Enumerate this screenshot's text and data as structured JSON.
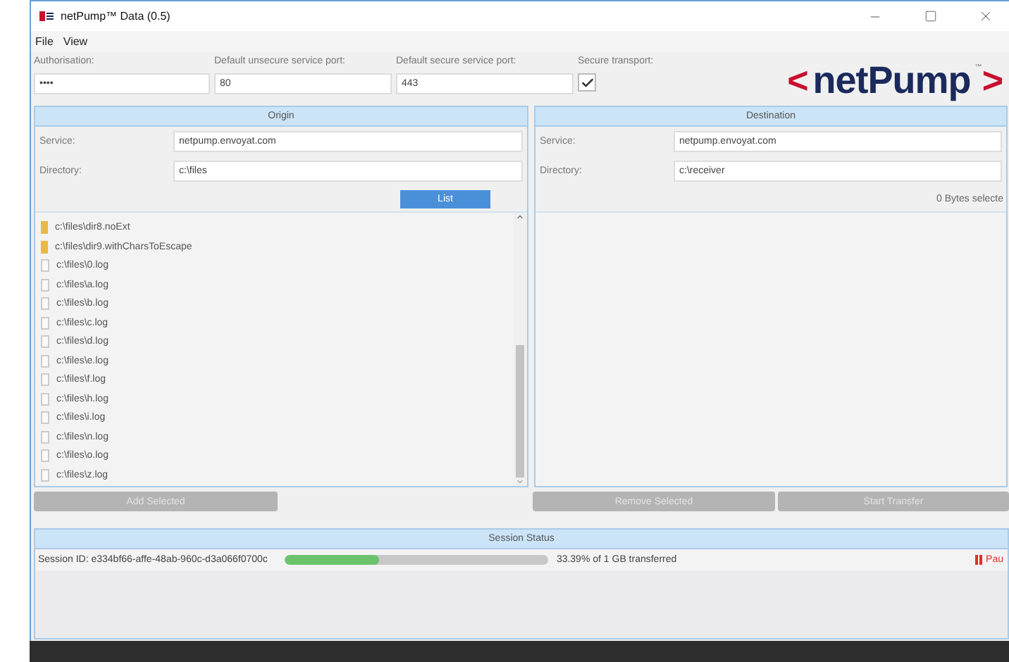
{
  "window": {
    "title": "netPump™ Data (0.5)"
  },
  "menu": [
    "File",
    "View"
  ],
  "settings": {
    "authorisation": {
      "label": "Authorisation:",
      "value": "••••"
    },
    "unsecure_port": {
      "label": "Default unsecure service port:",
      "value": "80"
    },
    "secure_port": {
      "label": "Default secure service port:",
      "value": "443"
    },
    "secure_transport": {
      "label": "Secure transport:",
      "checked": true
    }
  },
  "logo": {
    "left": "<",
    "name": "netPump",
    "tm": "™",
    "right": ">"
  },
  "origin": {
    "title": "Origin",
    "service_label": "Service:",
    "service": "netpump.envoyat.com",
    "directory_label": "Directory:",
    "directory": "c:\\files",
    "list_button": "List",
    "files": [
      {
        "kind": "folder",
        "name": "c:\\files\\dir8.noExt"
      },
      {
        "kind": "folder",
        "name": "c:\\files\\dir9.withCharsToEscape"
      },
      {
        "kind": "file",
        "name": "c:\\files\\0.log"
      },
      {
        "kind": "file",
        "name": "c:\\files\\a.log"
      },
      {
        "kind": "file",
        "name": "c:\\files\\b.log"
      },
      {
        "kind": "file",
        "name": "c:\\files\\c.log"
      },
      {
        "kind": "file",
        "name": "c:\\files\\d.log"
      },
      {
        "kind": "file",
        "name": "c:\\files\\e.log"
      },
      {
        "kind": "file",
        "name": "c:\\files\\f.log"
      },
      {
        "kind": "file",
        "name": "c:\\files\\h.log"
      },
      {
        "kind": "file",
        "name": "c:\\files\\i.log"
      },
      {
        "kind": "file",
        "name": "c:\\files\\n.log"
      },
      {
        "kind": "file",
        "name": "c:\\files\\o.log"
      },
      {
        "kind": "file",
        "name": "c:\\files\\z.log"
      }
    ],
    "add_button": {
      "label": "Add Selected",
      "disabled": true
    }
  },
  "destination": {
    "title": "Destination",
    "service_label": "Service:",
    "service": "netpump.envoyat.com",
    "directory_label": "Directory:",
    "directory": "c:\\receiver",
    "selected_size": "0 Bytes selecte",
    "remove_button": {
      "label": "Remove Selected",
      "disabled": true
    },
    "transfer_button": {
      "label": "Start Transfer",
      "disabled": true
    }
  },
  "session": {
    "title": "Session Status",
    "id": "Session ID: e334bf66-affe-48ab-960c-d3a066f0700c",
    "level": 0.36,
    "progress_text": "33.39% of 1 GB transferred",
    "pause": "Pau"
  }
}
